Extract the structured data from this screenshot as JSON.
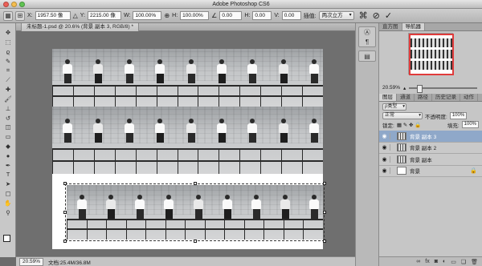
{
  "window": {
    "title": "Adobe Photoshop CS6"
  },
  "options": {
    "x_label": "X:",
    "x_value": "1957.50 像",
    "y_label": "Y:",
    "y_value": "2215.00 像",
    "w_label": "W:",
    "w_value": "100.00%",
    "h_label": "H:",
    "h_value": "100.00%",
    "angle_value": "0.00",
    "hskew_label": "H:",
    "hskew_value": "0.00",
    "vskew_label": "V:",
    "vskew_value": "0.00",
    "interp_label": "插值:",
    "interp_value": "两次立方",
    "cancel_icon": "cancel-icon",
    "commit_icon": "check-icon"
  },
  "document": {
    "tab_label": "未标题-1.psd @ 20.6% (背景 副本 3, RGB/8) *"
  },
  "status": {
    "zoom": "20.59%",
    "doc_info": "文档:25.4M/36.8M"
  },
  "panels": {
    "top_tabs": [
      "直方图",
      "导航器"
    ],
    "nav_zoom": "20.59%",
    "layer_tabs": [
      "图层",
      "通道",
      "路径",
      "历史记录",
      "动作"
    ],
    "kind_label": "ρ类型",
    "blend_mode": "正常",
    "opacity_label": "不透明度:",
    "opacity_value": "100%",
    "lock_label": "锁定:",
    "fill_label": "填充:",
    "fill_value": "100%"
  },
  "layers": [
    {
      "name": "背景 副本 3",
      "selected": true
    },
    {
      "name": "背景 副本 2",
      "selected": false
    },
    {
      "name": "背景 副本",
      "selected": false
    },
    {
      "name": "背景",
      "selected": false,
      "locked": true
    }
  ],
  "colors": {
    "accent_selection": "#8fa8c9",
    "nav_view_box": "#e03b3b"
  }
}
